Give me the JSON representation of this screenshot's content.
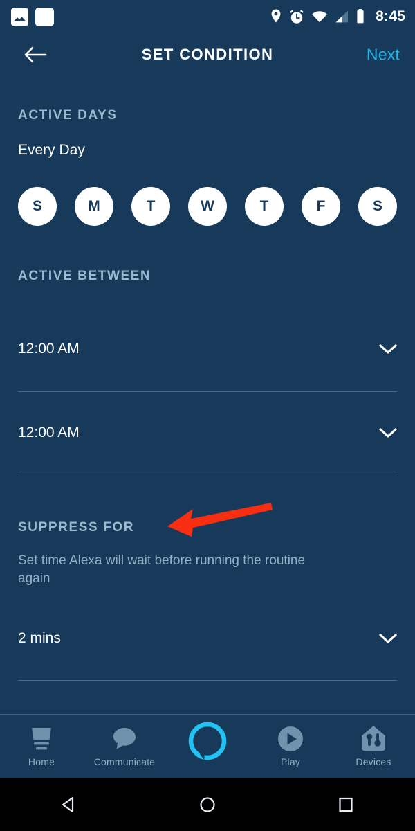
{
  "status_bar": {
    "time": "8:45",
    "left_icons": [
      "screenshot-image-icon",
      "blank-notification-icon"
    ],
    "right_icons": [
      "location-pin-icon",
      "alarm-clock-icon",
      "wifi-icon",
      "cellular-signal-icon",
      "battery-icon"
    ]
  },
  "header": {
    "back_icon": "back-arrow-icon",
    "title": "SET CONDITION",
    "next_label": "Next"
  },
  "colors": {
    "background": "#173a5a",
    "accent_cyan": "#1eb5ec",
    "section_label": "#9cbacf",
    "muted_text": "#94b0c6",
    "divider": "#436b88",
    "annotation_red": "#f72e12",
    "day_circle_fill": "#ffffff",
    "day_circle_text": "#16395a"
  },
  "active_days": {
    "label": "ACTIVE DAYS",
    "value": "Every Day",
    "days": [
      {
        "letter": "S",
        "name": "sunday",
        "selected": true
      },
      {
        "letter": "M",
        "name": "monday",
        "selected": true
      },
      {
        "letter": "T",
        "name": "tuesday",
        "selected": true
      },
      {
        "letter": "W",
        "name": "wednesday",
        "selected": true
      },
      {
        "letter": "T",
        "name": "thursday",
        "selected": true
      },
      {
        "letter": "F",
        "name": "friday",
        "selected": true
      },
      {
        "letter": "S",
        "name": "saturday",
        "selected": true
      }
    ]
  },
  "active_between": {
    "label": "ACTIVE BETWEEN",
    "start_time": "12:00 AM",
    "end_time": "12:00 AM",
    "chevron_icon": "chevron-down-icon"
  },
  "suppress_for": {
    "label": "SUPPRESS FOR",
    "description": "Set time Alexa will wait before running the routine again",
    "value": "2 mins",
    "chevron_icon": "chevron-down-icon"
  },
  "annotation": {
    "type": "red-arrow",
    "points_to": "SUPPRESS FOR"
  },
  "tab_bar": {
    "items": [
      {
        "label": "Home",
        "icon": "home-device-icon",
        "active": false
      },
      {
        "label": "Communicate",
        "icon": "speech-bubble-icon",
        "active": false
      },
      {
        "label": "",
        "icon": "alexa-ring-icon",
        "active": true
      },
      {
        "label": "Play",
        "icon": "play-circle-icon",
        "active": false
      },
      {
        "label": "Devices",
        "icon": "devices-house-icon",
        "active": false
      }
    ]
  },
  "android_nav": {
    "back": "nav-back-triangle-icon",
    "home": "nav-home-circle-icon",
    "recents": "nav-recents-square-icon"
  }
}
